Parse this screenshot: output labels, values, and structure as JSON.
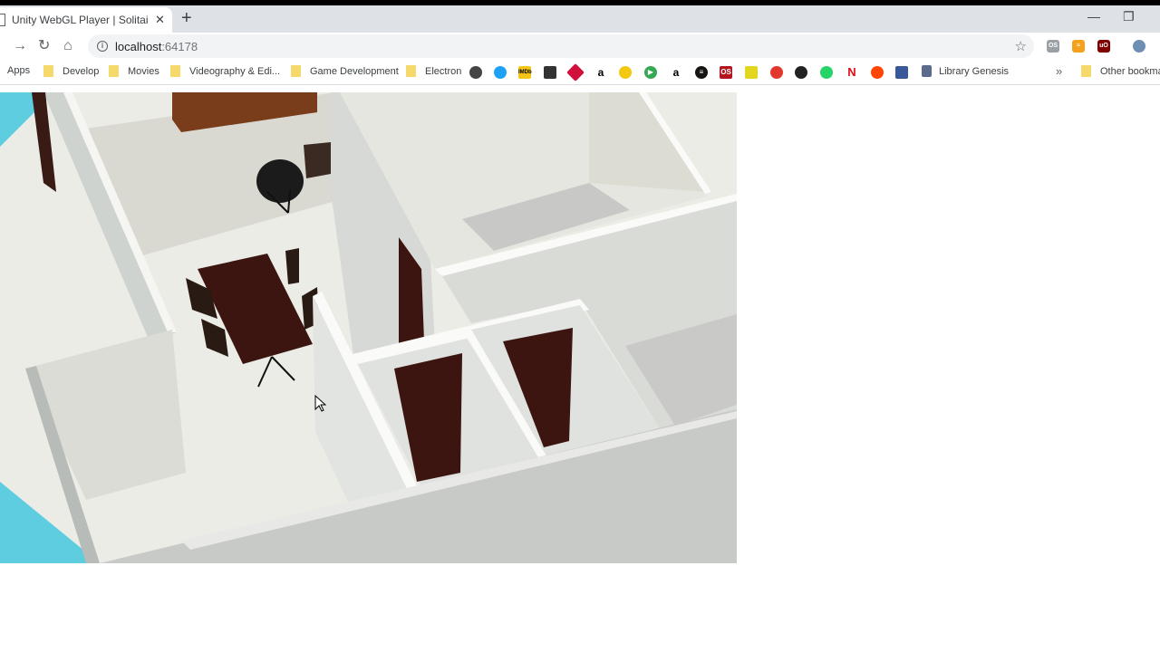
{
  "browser": {
    "tab_title": "Unity WebGL Player | Solitaire AR",
    "tab_close": "✕",
    "new_tab": "+",
    "url_host": "localhost",
    "url_port": ":64178",
    "window_controls": {
      "minimize": "—",
      "restore": "❐"
    }
  },
  "bookmarks": {
    "apps": "Apps",
    "items": [
      {
        "label": "Develop",
        "icon": "folder-icon"
      },
      {
        "label": "Movies",
        "icon": "folder-icon"
      },
      {
        "label": "Videography  & Edi...",
        "icon": "folder-icon"
      },
      {
        "label": "Game Development",
        "icon": "folder-icon"
      },
      {
        "label": "Electron",
        "icon": "folder-icon"
      },
      {
        "label": "Library Genesis",
        "icon": "library-icon"
      },
      {
        "label": "Other bookma",
        "icon": "folder-icon"
      }
    ],
    "overflow": "»",
    "favicon_badges": {
      "imdb": "IMDb",
      "os": "OS",
      "netflix": "N",
      "amazon": "a"
    }
  },
  "extensions": {
    "os": "OS",
    "ublock": "uO"
  },
  "colors": {
    "tabstrip": "#dee1e6",
    "sky": "#5fcde0",
    "floor": "#ecece6",
    "wall": "#d4d7d3",
    "door": "#4b1d14"
  }
}
